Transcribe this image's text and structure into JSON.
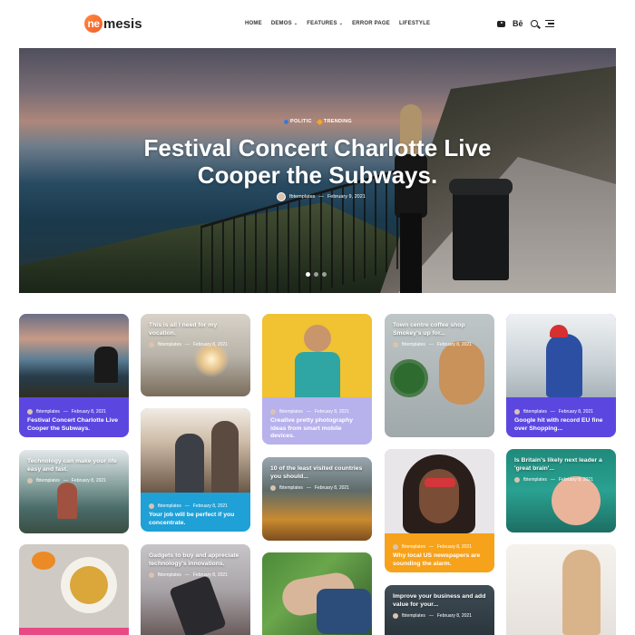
{
  "logo": {
    "mark": "ne",
    "text": "mesis"
  },
  "nav": {
    "items": [
      {
        "label": "HOME",
        "caret": false
      },
      {
        "label": "DEMOS",
        "caret": true
      },
      {
        "label": "FEATURES",
        "caret": true
      },
      {
        "label": "ERROR PAGE",
        "caret": false
      },
      {
        "label": "LIFESTYLE",
        "caret": false
      }
    ],
    "caret": "⌄",
    "behance": "Bē"
  },
  "hero": {
    "tags": [
      {
        "label": "POLITIC",
        "color": "#3a7bd5"
      },
      {
        "label": "TRENDING",
        "color": "#f5a623"
      }
    ],
    "title_line1": "Festival Concert Charlotte Live",
    "title_line2": "Cooper the Subways.",
    "author": "fbtemplates",
    "sep": "—",
    "date": "February 9, 2021",
    "slides": [
      true,
      false,
      false
    ]
  },
  "cards": [
    {
      "id": "c1",
      "title": "Festival Concert Charlotte Live Cooper the Subways.",
      "author": "fbtemplates",
      "date": "February 8, 2021",
      "color": "#5b47e0"
    },
    {
      "id": "c2",
      "title": "This is all I need for my vocation.",
      "author": "fbtemplates",
      "date": "February 8, 2021"
    },
    {
      "id": "c3",
      "title": "Creative pretty photography ideas from smart mobile devices.",
      "author": "fbtemplates",
      "date": "February 8, 2021",
      "color": "#b7b1ec"
    },
    {
      "id": "c4",
      "title": "Town centre coffee shop Smokey's up for...",
      "author": "fbtemplates",
      "date": "February 8, 2021"
    },
    {
      "id": "c5",
      "title": "Google hit with record EU fine over Shopping...",
      "author": "fbtemplates",
      "date": "February 8, 2021",
      "color": "#5b47e0"
    },
    {
      "id": "c6",
      "title": "Technology can make your life easy and fast.",
      "author": "fbtemplates",
      "date": "February 8, 2021"
    },
    {
      "id": "c7",
      "title": "Your job will be perfect if you concentrate.",
      "author": "fbtemplates",
      "date": "February 8, 2021",
      "color": "#1fa0d6"
    },
    {
      "id": "c8",
      "title": "10 of the least visited countries you should...",
      "author": "fbtemplates",
      "date": "February 8, 2021"
    },
    {
      "id": "c9",
      "title": "Why local US newspapers are sounding the alarm.",
      "author": "fbtemplates",
      "date": "February 8, 2021",
      "color": "#f7a21b"
    },
    {
      "id": "c10",
      "title": "Is Britain's likely next leader a 'great brain'...",
      "author": "fbtemplates",
      "date": "February 8, 2021"
    },
    {
      "id": "c11",
      "title": "Gadgets to buy and appreciate technology's innovations.",
      "author": "fbtemplates",
      "date": "February 8, 2021"
    },
    {
      "id": "c12",
      "title": "Improve your business and add value for your...",
      "author": "fbtemplates",
      "date": "February 8, 2021"
    }
  ]
}
